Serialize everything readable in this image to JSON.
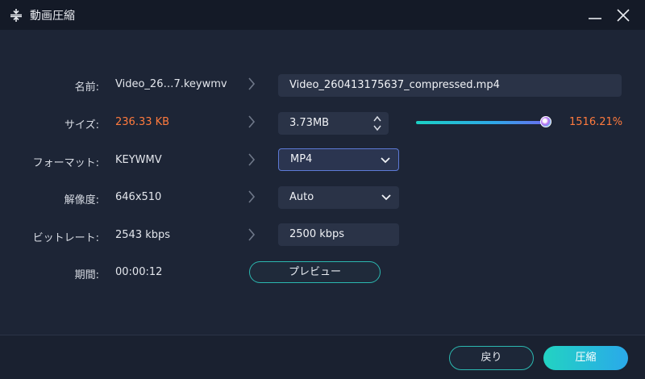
{
  "window": {
    "title": "動画圧縮"
  },
  "rows": {
    "name": {
      "label": "名前:",
      "source": "Video_26…7.keywmv",
      "output": "Video_260413175637_compressed.mp4"
    },
    "size": {
      "label": "サイズ:",
      "source": "236.33 KB",
      "output": "3.73MB",
      "percent": "1516.21%",
      "slider_fraction": 1.0
    },
    "format": {
      "label": "フォーマット:",
      "source": "KEYWMV",
      "output": "MP4"
    },
    "resolution": {
      "label": "解像度:",
      "source": "646x510",
      "output": "Auto"
    },
    "bitrate": {
      "label": "ビットレート:",
      "source": "2543 kbps",
      "output": "2500 kbps"
    },
    "duration": {
      "label": "期間:",
      "source": "00:00:12"
    }
  },
  "buttons": {
    "preview": "プレビュー",
    "back": "戻り",
    "compress": "圧縮"
  },
  "colors": {
    "accent_teal": "#2bb8b0",
    "highlight_orange": "#ff7a3d",
    "background": "#1d2536"
  },
  "icons": [
    "compress-icon",
    "minimize-icon",
    "close-icon",
    "chevron-right-icon",
    "chevron-down-icon",
    "stepper-icon"
  ]
}
